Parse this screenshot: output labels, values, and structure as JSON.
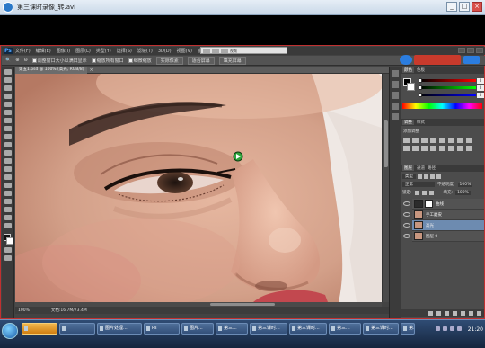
{
  "player": {
    "title": "第三课时录像_转.avi",
    "window_buttons": [
      "_",
      "□",
      "×"
    ]
  },
  "ps": {
    "logo": "Ps",
    "menu": [
      "文件(F)",
      "编辑(E)",
      "图像(I)",
      "图层(L)",
      "类型(Y)",
      "选择(S)",
      "滤镜(T)",
      "3D(D)",
      "视图(V)",
      "窗口"
    ],
    "float_toolbar_label": "视频",
    "options": {
      "resize_windows_label": "调整窗口大小以满屏显示",
      "zoom_all_label": "缩放所有窗口",
      "scrubby_zoom_label": "细微缩放",
      "actual_pixels_label": "实际像素",
      "fit_screen_label": "适合屏幕",
      "fill_screen_label": "填充屏幕"
    },
    "document_tab": {
      "label": "第五1.psd @ 100% (高光, RGB/8)",
      "close": "×"
    },
    "status": {
      "zoom": "100%",
      "doc_size": "文档:16.7M/73.4M"
    },
    "color_panel": {
      "tabs": [
        "颜色",
        "色板"
      ],
      "r": 0,
      "g": 0,
      "b": 0
    },
    "adjustments_panel": {
      "tabs": [
        "调整",
        "样式"
      ],
      "title": "添加调整"
    },
    "layers_panel": {
      "tabs": [
        "图层",
        "通道",
        "路径"
      ],
      "kind_label": "类型",
      "blend_mode": "正常",
      "opacity_label": "不透明度:",
      "opacity": "100%",
      "lock_label": "锁定:",
      "fill_label": "填充:",
      "fill": "100%",
      "layers": [
        {
          "name": "曲线",
          "selected": false,
          "mask": true
        },
        {
          "name": "手工磨皮",
          "selected": false,
          "mask": false
        },
        {
          "name": "高光",
          "selected": true,
          "mask": false
        },
        {
          "name": "图层 0",
          "selected": false,
          "mask": false
        }
      ]
    }
  },
  "taskbar": {
    "items": [
      {
        "label": "",
        "active": true
      },
      {
        "label": "",
        "active": false
      },
      {
        "label": "图片处理...",
        "active": false
      },
      {
        "label": "Ps",
        "active": false
      },
      {
        "label": "图片...",
        "active": false
      },
      {
        "label": "第三...",
        "active": false
      },
      {
        "label": "第三课时...",
        "active": false
      },
      {
        "label": "第三课时...",
        "active": false
      },
      {
        "label": "第三...",
        "active": false
      },
      {
        "label": "第三课时...",
        "active": false
      },
      {
        "label": "第三...",
        "active": false
      }
    ],
    "clock": "21:20"
  },
  "colors": {
    "accent_red": "#c03030",
    "ps_bg": "#434343",
    "selected_layer": "#6d8bb0"
  }
}
